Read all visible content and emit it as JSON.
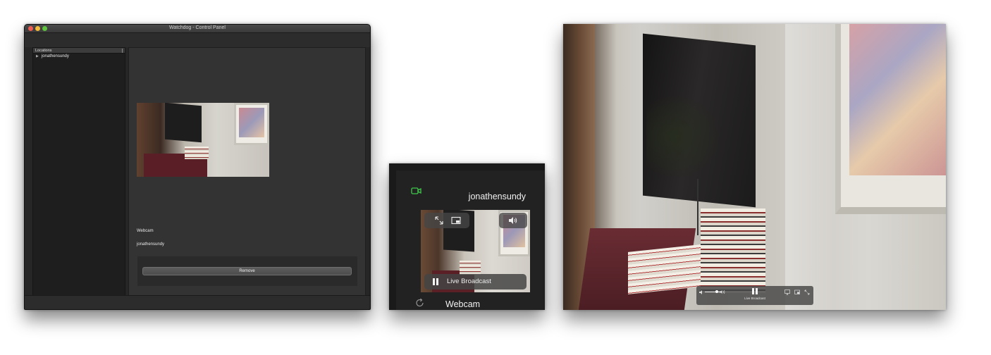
{
  "control_panel": {
    "window_title": "Watchdog - Control Panel",
    "sidebar": {
      "header": "Locations",
      "items": [
        {
          "label": "jonathensundy",
          "expanded": false
        }
      ]
    },
    "detail": {
      "camera_name": "Webcam",
      "location_name": "jonathensundy",
      "remove_label": "Remove"
    }
  },
  "widget": {
    "location_name": "jonathensundy",
    "camera_name": "Webcam",
    "broadcast_label": "Live Broadcast",
    "accent_color": "#3fc94b",
    "icons": [
      "video-camera-icon",
      "fullscreen-icon",
      "picture-in-picture-icon",
      "speaker-icon",
      "pause-icon",
      "refresh-icon"
    ]
  },
  "full_view": {
    "broadcast_label": "Live Broadcast",
    "volume_level": 0.7,
    "icons": [
      "volume-low-icon",
      "volume-high-icon",
      "pause-icon",
      "airplay-icon",
      "picture-in-picture-icon",
      "fullscreen-icon"
    ]
  }
}
